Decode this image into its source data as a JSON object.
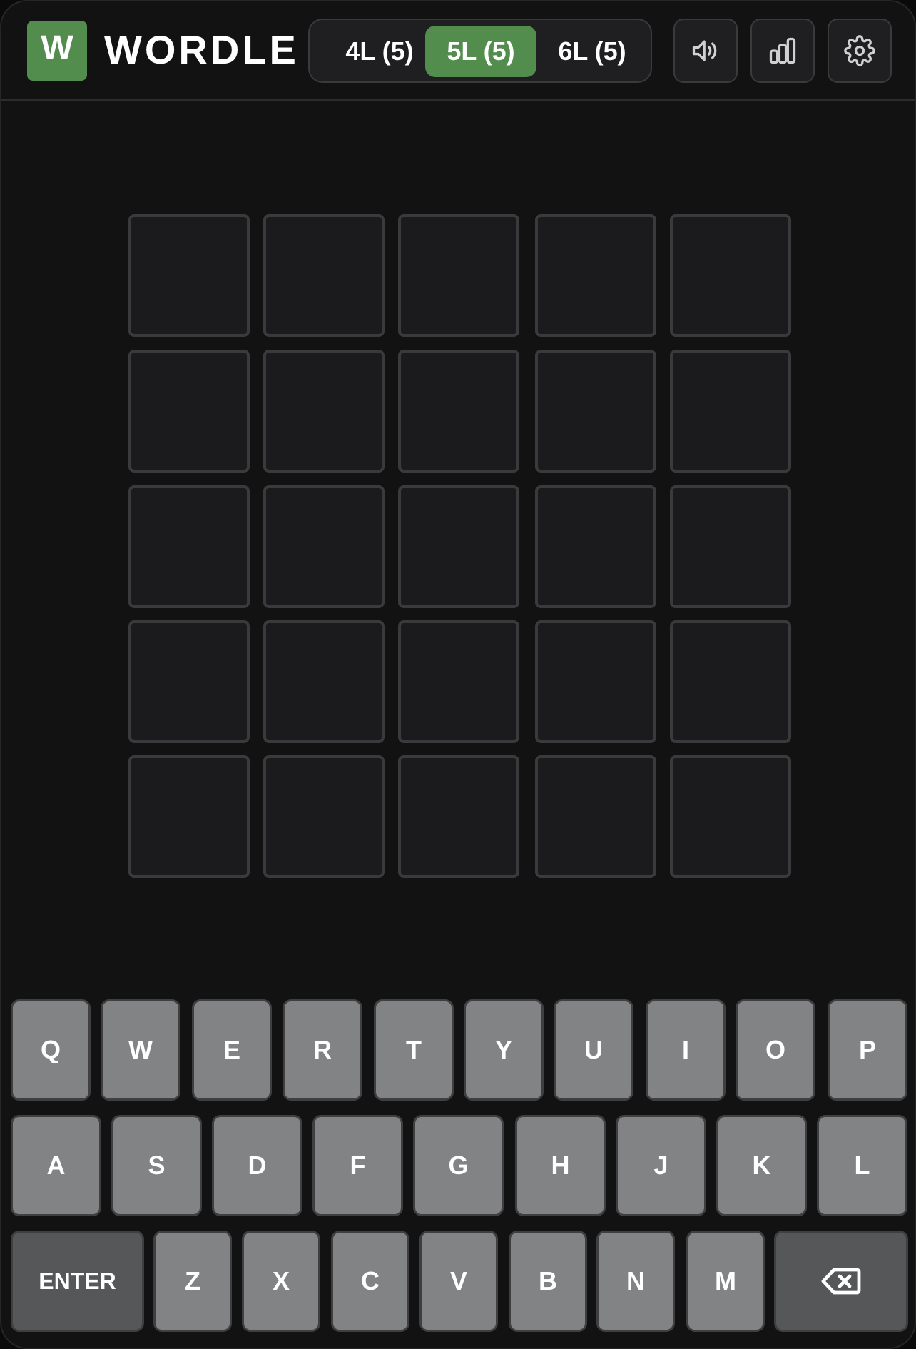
{
  "app": {
    "logo_letter": "W",
    "title": "WORDLE"
  },
  "modes": [
    {
      "label": "4L (5)",
      "active": false
    },
    {
      "label": "5L (5)",
      "active": true
    },
    {
      "label": "6L (5)",
      "active": false
    }
  ],
  "toolbar": {
    "icons": [
      "sound-icon",
      "stats-icon",
      "settings-icon"
    ]
  },
  "board": {
    "rows": [
      [
        "",
        "",
        "",
        "",
        ""
      ],
      [
        "",
        "",
        "",
        "",
        ""
      ],
      [
        "",
        "",
        "",
        "",
        ""
      ],
      [
        "",
        "",
        "",
        "",
        ""
      ],
      [
        "",
        "",
        "",
        "",
        ""
      ]
    ]
  },
  "keyboard": {
    "row1": [
      "Q",
      "W",
      "E",
      "R",
      "T",
      "Y",
      "U",
      "I",
      "O",
      "P"
    ],
    "row2": [
      "A",
      "S",
      "D",
      "F",
      "G",
      "H",
      "J",
      "K",
      "L"
    ],
    "row3": [
      "Z",
      "X",
      "C",
      "V",
      "B",
      "N",
      "M"
    ],
    "enter_label": "ENTER",
    "backspace_icon": "backspace-icon"
  },
  "colors": {
    "accent": "#538d4e",
    "key": "#818384",
    "key_wide": "#565758",
    "tile_border": "#3a3a3c",
    "background": "#121212"
  }
}
